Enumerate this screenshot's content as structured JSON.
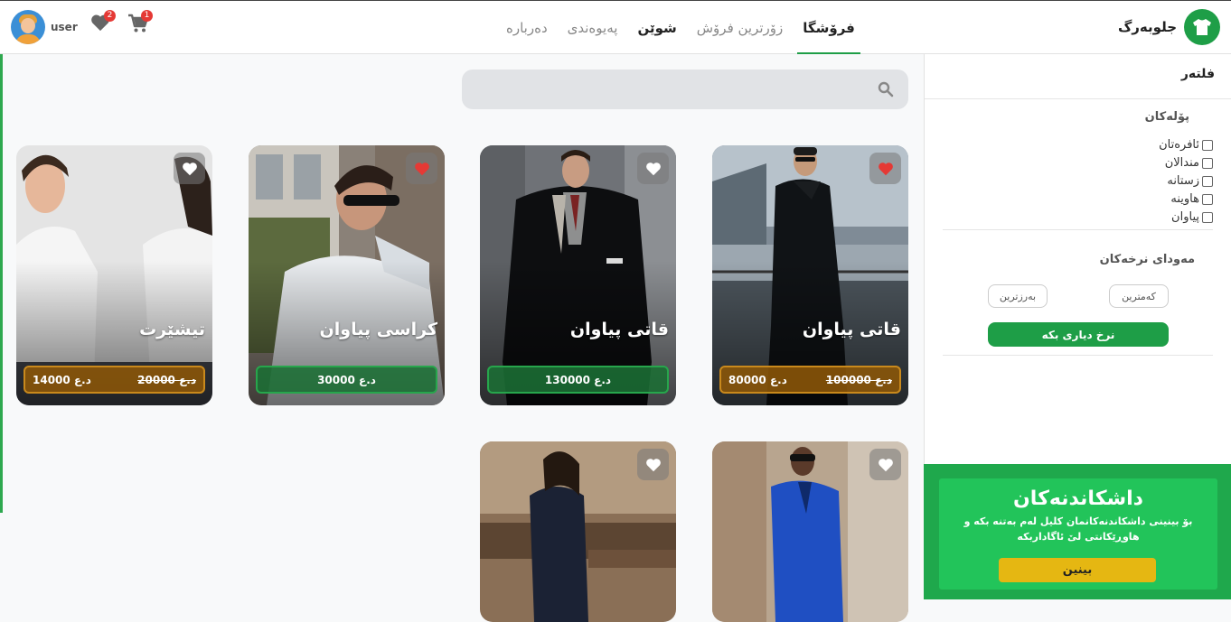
{
  "header": {
    "brand": "جلوبەرگ",
    "nav": [
      "فرۆشگا",
      "زۆرترین فرۆش",
      "شوێن",
      "پەیوەندی",
      "دەرباره"
    ],
    "user_name": "user",
    "favorites_count": "2",
    "cart_count": "1"
  },
  "search": {
    "placeholder": ""
  },
  "sidebar": {
    "filter_title": "فلتەر",
    "categories_title": "پۆلەکان",
    "categories": [
      "ئافرەتان",
      "مندالان",
      "زستانە",
      "هاوینە",
      "پیاوان"
    ],
    "price_title": "مەودای نرخەکان",
    "lowest_label": "کەمترین",
    "highest_label": "بەرزترین",
    "apply_label": "نرخ دیاری بکە"
  },
  "promo": {
    "title": "داشکاندنەکان",
    "text": "بۆ بینینی داشکاندنەکانمان کلیل لەم بەتنە بکە و هاوڕێکانتی لێ ئاگاداربکە",
    "button": "بینین"
  },
  "products": [
    {
      "title": "قاتی پیاوان",
      "price": "80000 د.ع",
      "old_price": "100000 د.ع",
      "favorite": true,
      "colors": {
        "accent": "#e53935"
      }
    },
    {
      "title": "قاتی پیاوان",
      "price": "130000 د.ع",
      "old_price": "",
      "favorite": false
    },
    {
      "title": "کراسی پیاوان",
      "price": "30000 د.ع",
      "old_price": "",
      "favorite": true
    },
    {
      "title": "تیشێرت",
      "price": "14000 د.ع",
      "old_price": "20000 د.ع",
      "favorite": false
    },
    {
      "title": "",
      "price": "",
      "old_price": "",
      "favorite": false
    },
    {
      "title": "",
      "price": "",
      "old_price": "",
      "favorite": false
    }
  ],
  "colors": {
    "brand": "#1e9e47",
    "sale": "#c9891c",
    "badge": "#e53935",
    "promo_button": "#e5b712"
  }
}
